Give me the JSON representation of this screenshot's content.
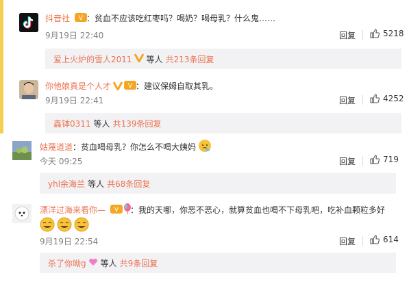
{
  "comments": [
    {
      "user": "抖音社",
      "text": "：贫血不应该吃红枣吗？喝奶？喝母乳？什么鬼……",
      "time": "9月19日 22:40",
      "reply_label": "回复",
      "likes": "5218",
      "sub": {
        "user": "爱上火炉的雪人2011",
        "mid": "等人",
        "count": "共213条回复"
      }
    },
    {
      "user": "你他娘真是个人才",
      "text": "：建议保姆自取其乳。",
      "time": "9月19日 22:41",
      "reply_label": "回复",
      "likes": "4252",
      "sub": {
        "user": "鑫钵0311",
        "mid": "等人",
        "count": "共139条回复"
      }
    },
    {
      "user": "姑蔑道道",
      "text": "：贫血喝母乳？你怎么不喝大姨妈",
      "time": "今天 09:25",
      "reply_label": "回复",
      "likes": "719",
      "sub": {
        "user": "yhl余海兰",
        "mid": "等人",
        "count": "共68条回复"
      }
    },
    {
      "user": "漂洋过海来看你—",
      "text": "：我的天哪，你恶不恶心，就算贫血也喝不下母乳吧，吃补血颗粒多好",
      "time": "9月19日 22:54",
      "reply_label": "回复",
      "likes": "614",
      "sub": {
        "user": "杀了你呦g",
        "mid": "等人",
        "count": "共9条回复"
      }
    }
  ],
  "colors": {
    "username": "#eb7350",
    "subbox_bg": "#f2f2f5",
    "stripe": "#f5cf54"
  }
}
